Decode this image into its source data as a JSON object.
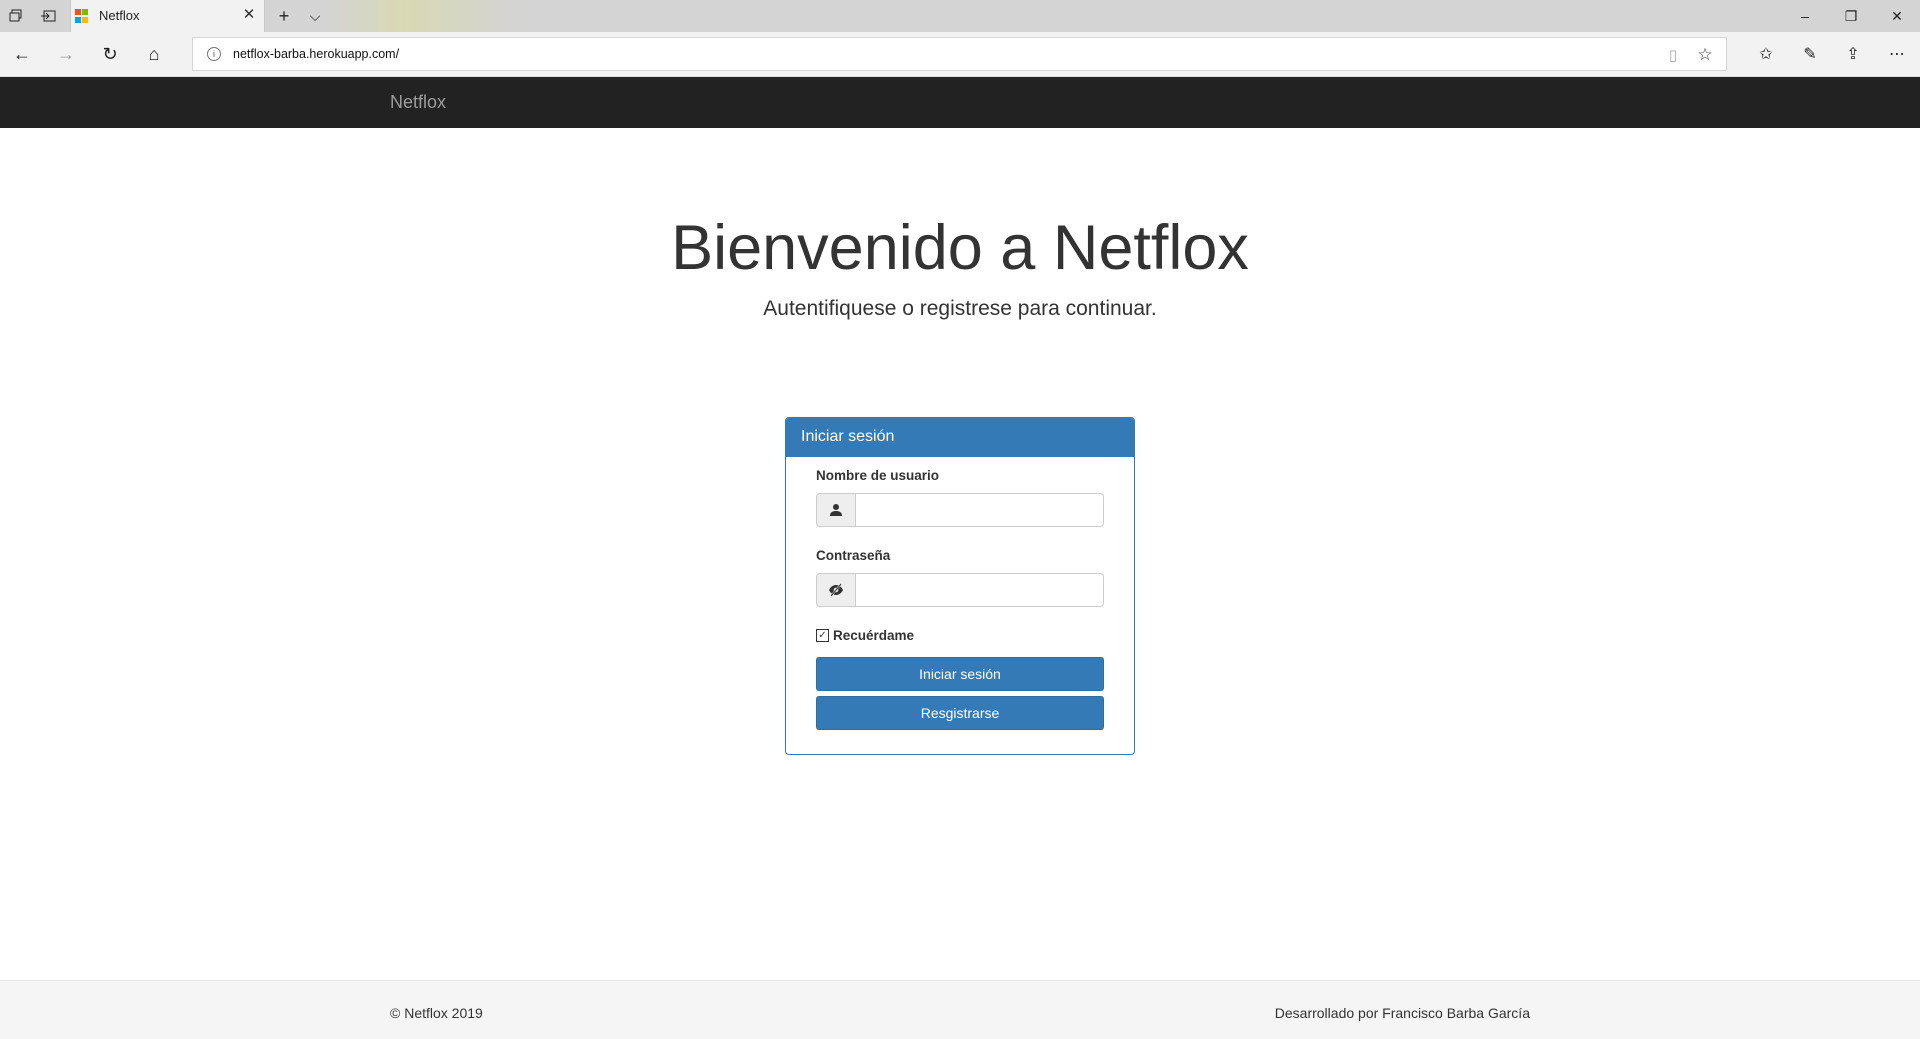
{
  "browser": {
    "tab_title": "Netflox",
    "url": "netflox-barba.herokuapp.com/",
    "icons": {
      "tab_actions": "tab-actions-icon",
      "set_aside": "set-aside-tabs-icon",
      "new_tab": "+",
      "tab_list": "⌵",
      "close_tab": "✕",
      "minimize": "–",
      "restore": "❐",
      "close_window": "✕",
      "back": "←",
      "forward": "→",
      "refresh": "↻",
      "home": "⌂",
      "reading_view": "▯",
      "favorite": "☆",
      "favorites_hub": "✩",
      "pen": "✎",
      "share": "⇪",
      "more": "⋯"
    },
    "favicon_colors": [
      "#f25022",
      "#7fba00",
      "#00a4ef",
      "#ffb900"
    ]
  },
  "site": {
    "brand": "Netflox"
  },
  "hero": {
    "title": "Bienvenido a Netflox",
    "subtitle": "Autentifiquese o registrese para continuar."
  },
  "login_panel": {
    "heading": "Iniciar sesión",
    "username_label": "Nombre de usuario",
    "username_value": "",
    "username_icon": "user-icon",
    "password_label": "Contraseña",
    "password_value": "",
    "password_icon": "eye-hidden-icon",
    "remember_label": "Recuérdame",
    "remember_checked": true,
    "login_button": "Iniciar sesión",
    "register_button": "Resgistrarse",
    "accent_color": "#337ab7"
  },
  "footer": {
    "copyright": "© Netflox 2019",
    "credits": "Desarrollado por Francisco Barba García"
  }
}
